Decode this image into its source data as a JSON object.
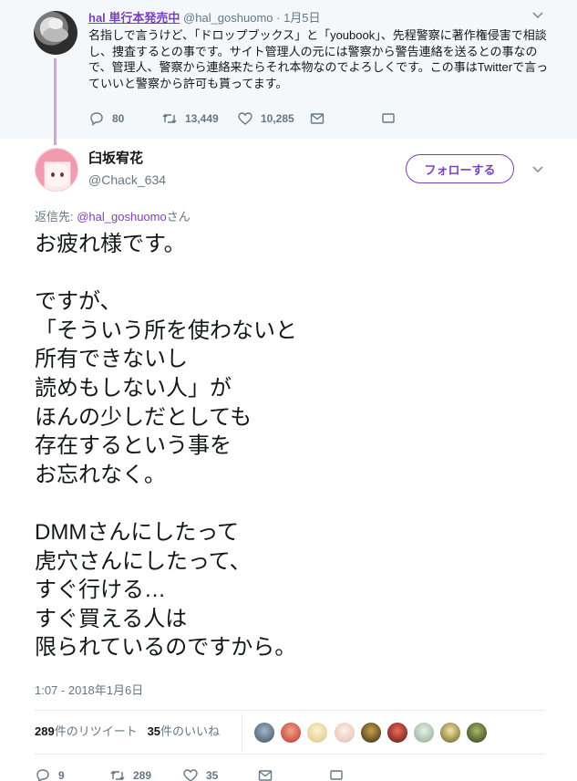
{
  "parent": {
    "name": "hal 単行本発売中",
    "handle": "@hal_goshuomo",
    "time": "· 1月5日",
    "text": "名指しで言うけど、「ドロップブックス」と「youbook」、先程警察に著作権侵害で相談し、捜査するとの事です。サイト管理人の元には警察から警告連絡を送るとの事なので、管理人、警察から連絡来たらそれ本物なのでよろしくです。この事はTwitterで言っていいと警察から許可も貰ってます。",
    "counts": {
      "reply": "80",
      "retweet": "13,449",
      "like": "10,285"
    }
  },
  "tweet": {
    "name": "臼坂宥花",
    "handle": "@Chack_634",
    "follow_label": "フォローする",
    "reply_prefix": "返信先: ",
    "reply_link": "@hal_goshuomo",
    "reply_suffix": "さん",
    "text": "お疲れ様です。\n\nですが、\n「そういう所を使わないと\n所有できないし\n読めもしない人」が\nほんの少しだとしても\n存在するという事を\nお忘れなく。\n\nDMMさんにしたって\n虎穴さんにしたって、\nすぐ行ける…\nすぐ買える人は\n限られているのですから。",
    "timestamp": "1:07 - 2018年1月6日",
    "retweets_count": "289",
    "retweets_label": "件のリツイート",
    "likes_count": "35",
    "likes_label": "件のいいね",
    "counts": {
      "reply": "9",
      "retweet": "289",
      "like": "35"
    }
  },
  "colors": {
    "accent": "#7b3fbf",
    "thread_line": "#c6a6e8",
    "muted": "#657786",
    "parent_bg": "#f5f8fa"
  },
  "icons": [
    "reply-icon",
    "retweet-icon",
    "like-icon",
    "message-icon",
    "bookmark-icon",
    "chevron-down-icon"
  ]
}
